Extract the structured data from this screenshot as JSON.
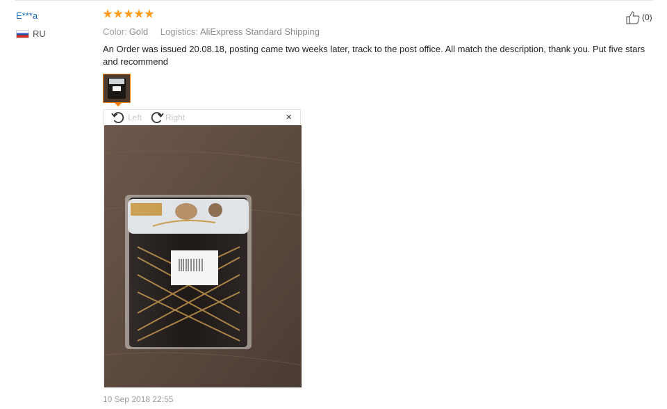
{
  "review": {
    "buyer_name": "E***a",
    "country_code": "RU",
    "rating": 5,
    "helpful_count": "(0)",
    "properties": [
      {
        "key": "Color:",
        "value": "Gold"
      },
      {
        "key": "Logistics:",
        "value": "AliExpress Standard Shipping"
      }
    ],
    "feedback_text": "An Order was issued 20.08.18, posting came two weeks later, track to the post office. All match the description, thank you. Put five stars and recommend",
    "date": "10 Sep 2018 22:55"
  },
  "viewer": {
    "rotate_left_label": "Left",
    "rotate_right_label": "Right",
    "close_label": "×"
  },
  "colors": {
    "star": "#ff9b1d",
    "buyer_link": "#1d6fb8",
    "thumb_border": "#ff7e00"
  },
  "icons": {
    "helpful": "thumbs-up-icon",
    "rotate_left": "rotate-left-icon",
    "rotate_right": "rotate-right-icon",
    "close": "close-icon",
    "flag": "russia-flag-icon"
  }
}
